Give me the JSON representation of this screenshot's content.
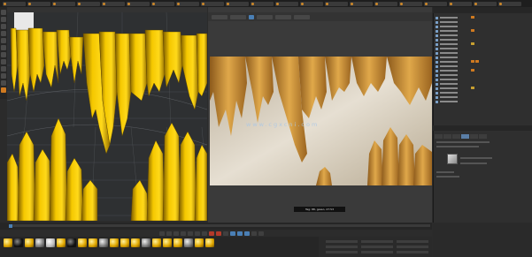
{
  "top_tabs": [
    "",
    "",
    "",
    "",
    "",
    "",
    "",
    "",
    "",
    "",
    "",
    "",
    "",
    "",
    "",
    "",
    "",
    "",
    "",
    "",
    ""
  ],
  "viewport_menu": [
    "",
    "",
    "",
    "",
    ""
  ],
  "render_menu": [
    "",
    "",
    "",
    ""
  ],
  "right_panel_tabs": [
    "",
    "",
    "",
    ""
  ],
  "render": {
    "watermark": "www.cgxcni.com",
    "caption": "Tag: 88, gesso, 27:53"
  },
  "colors": {
    "accent_orange": "#d07a20",
    "selection_blue": "#4a7fb5",
    "gold": "#f2c200",
    "gold_dark": "#8a6a00",
    "render_bg": "#cfc5b4",
    "render_honey": "#d09a3a"
  },
  "materials": [
    "gold",
    "black",
    "gold",
    "grey",
    "white",
    "gold",
    "black",
    "gold",
    "gold",
    "grey",
    "gold",
    "gold",
    "gold",
    "grey",
    "gold",
    "gold",
    "gold",
    "grey",
    "gold",
    "gold"
  ]
}
